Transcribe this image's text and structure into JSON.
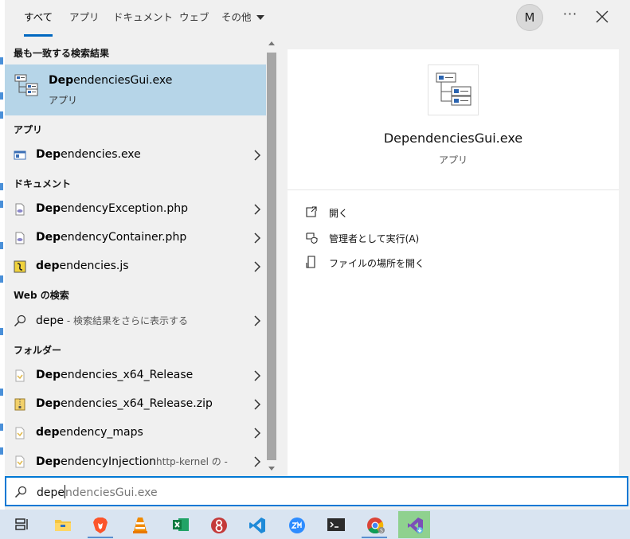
{
  "tabs": [
    {
      "label": "すべて",
      "active": true
    },
    {
      "label": "アプリ"
    },
    {
      "label": "ドキュメント"
    },
    {
      "label": "ウェブ"
    },
    {
      "label": "その他"
    }
  ],
  "account": {
    "initial": "M"
  },
  "menu": {
    "more_label": "···"
  },
  "best_match": {
    "heading": "最も一致する検索結果",
    "name_bold": "Dep",
    "name_rest": "endenciesGui.exe",
    "type": "アプリ"
  },
  "sections": {
    "apps": "アプリ",
    "documents": "ドキュメント",
    "web": "Web の検索",
    "folders": "フォルダー"
  },
  "apps": [
    {
      "bold": "Dep",
      "rest": "endencies.exe",
      "icon": "app-window-icon"
    }
  ],
  "documents": [
    {
      "bold": "Dep",
      "rest": "endencyException.php",
      "icon": "php-file-icon"
    },
    {
      "bold": "Dep",
      "rest": "endencyContainer.php",
      "icon": "php-file-icon"
    },
    {
      "bold": "dep",
      "rest": "endencies.js",
      "icon": "js-file-icon"
    }
  ],
  "web": [
    {
      "query": "depe",
      "hint": " - 検索結果をさらに表示する",
      "icon": "search-icon"
    }
  ],
  "folders": [
    {
      "bold": "Dep",
      "rest": "endencies_x64_Release",
      "hint": "",
      "icon": "folder-icon"
    },
    {
      "bold": "Dep",
      "rest": "endencies_x64_Release.zip",
      "hint": "",
      "icon": "zip-folder-icon"
    },
    {
      "bold": "dep",
      "rest": "endency_maps",
      "hint": "",
      "icon": "folder-icon"
    },
    {
      "bold": "Dep",
      "rest": "endencyInjection",
      "hint": "http-kernel の -",
      "icon": "folder-icon"
    }
  ],
  "preview": {
    "title": "DependenciesGui.exe",
    "type": "アプリ",
    "actions": [
      {
        "label": "開く",
        "icon": "open-icon"
      },
      {
        "label": "管理者として実行(A)",
        "icon": "shield-icon"
      },
      {
        "label": "ファイルの場所を開く",
        "icon": "file-location-icon"
      }
    ]
  },
  "search": {
    "typed": "depe",
    "suggestion": "ndenciesGui.exe"
  },
  "taskbar": [
    "task-view-icon",
    "file-explorer-icon",
    "brave-icon",
    "vlc-icon",
    "excel-icon",
    "git-icon",
    "vscode-icon",
    "zoom-icon",
    "terminal-icon",
    "chrome-icon",
    "visual-studio-icon"
  ]
}
